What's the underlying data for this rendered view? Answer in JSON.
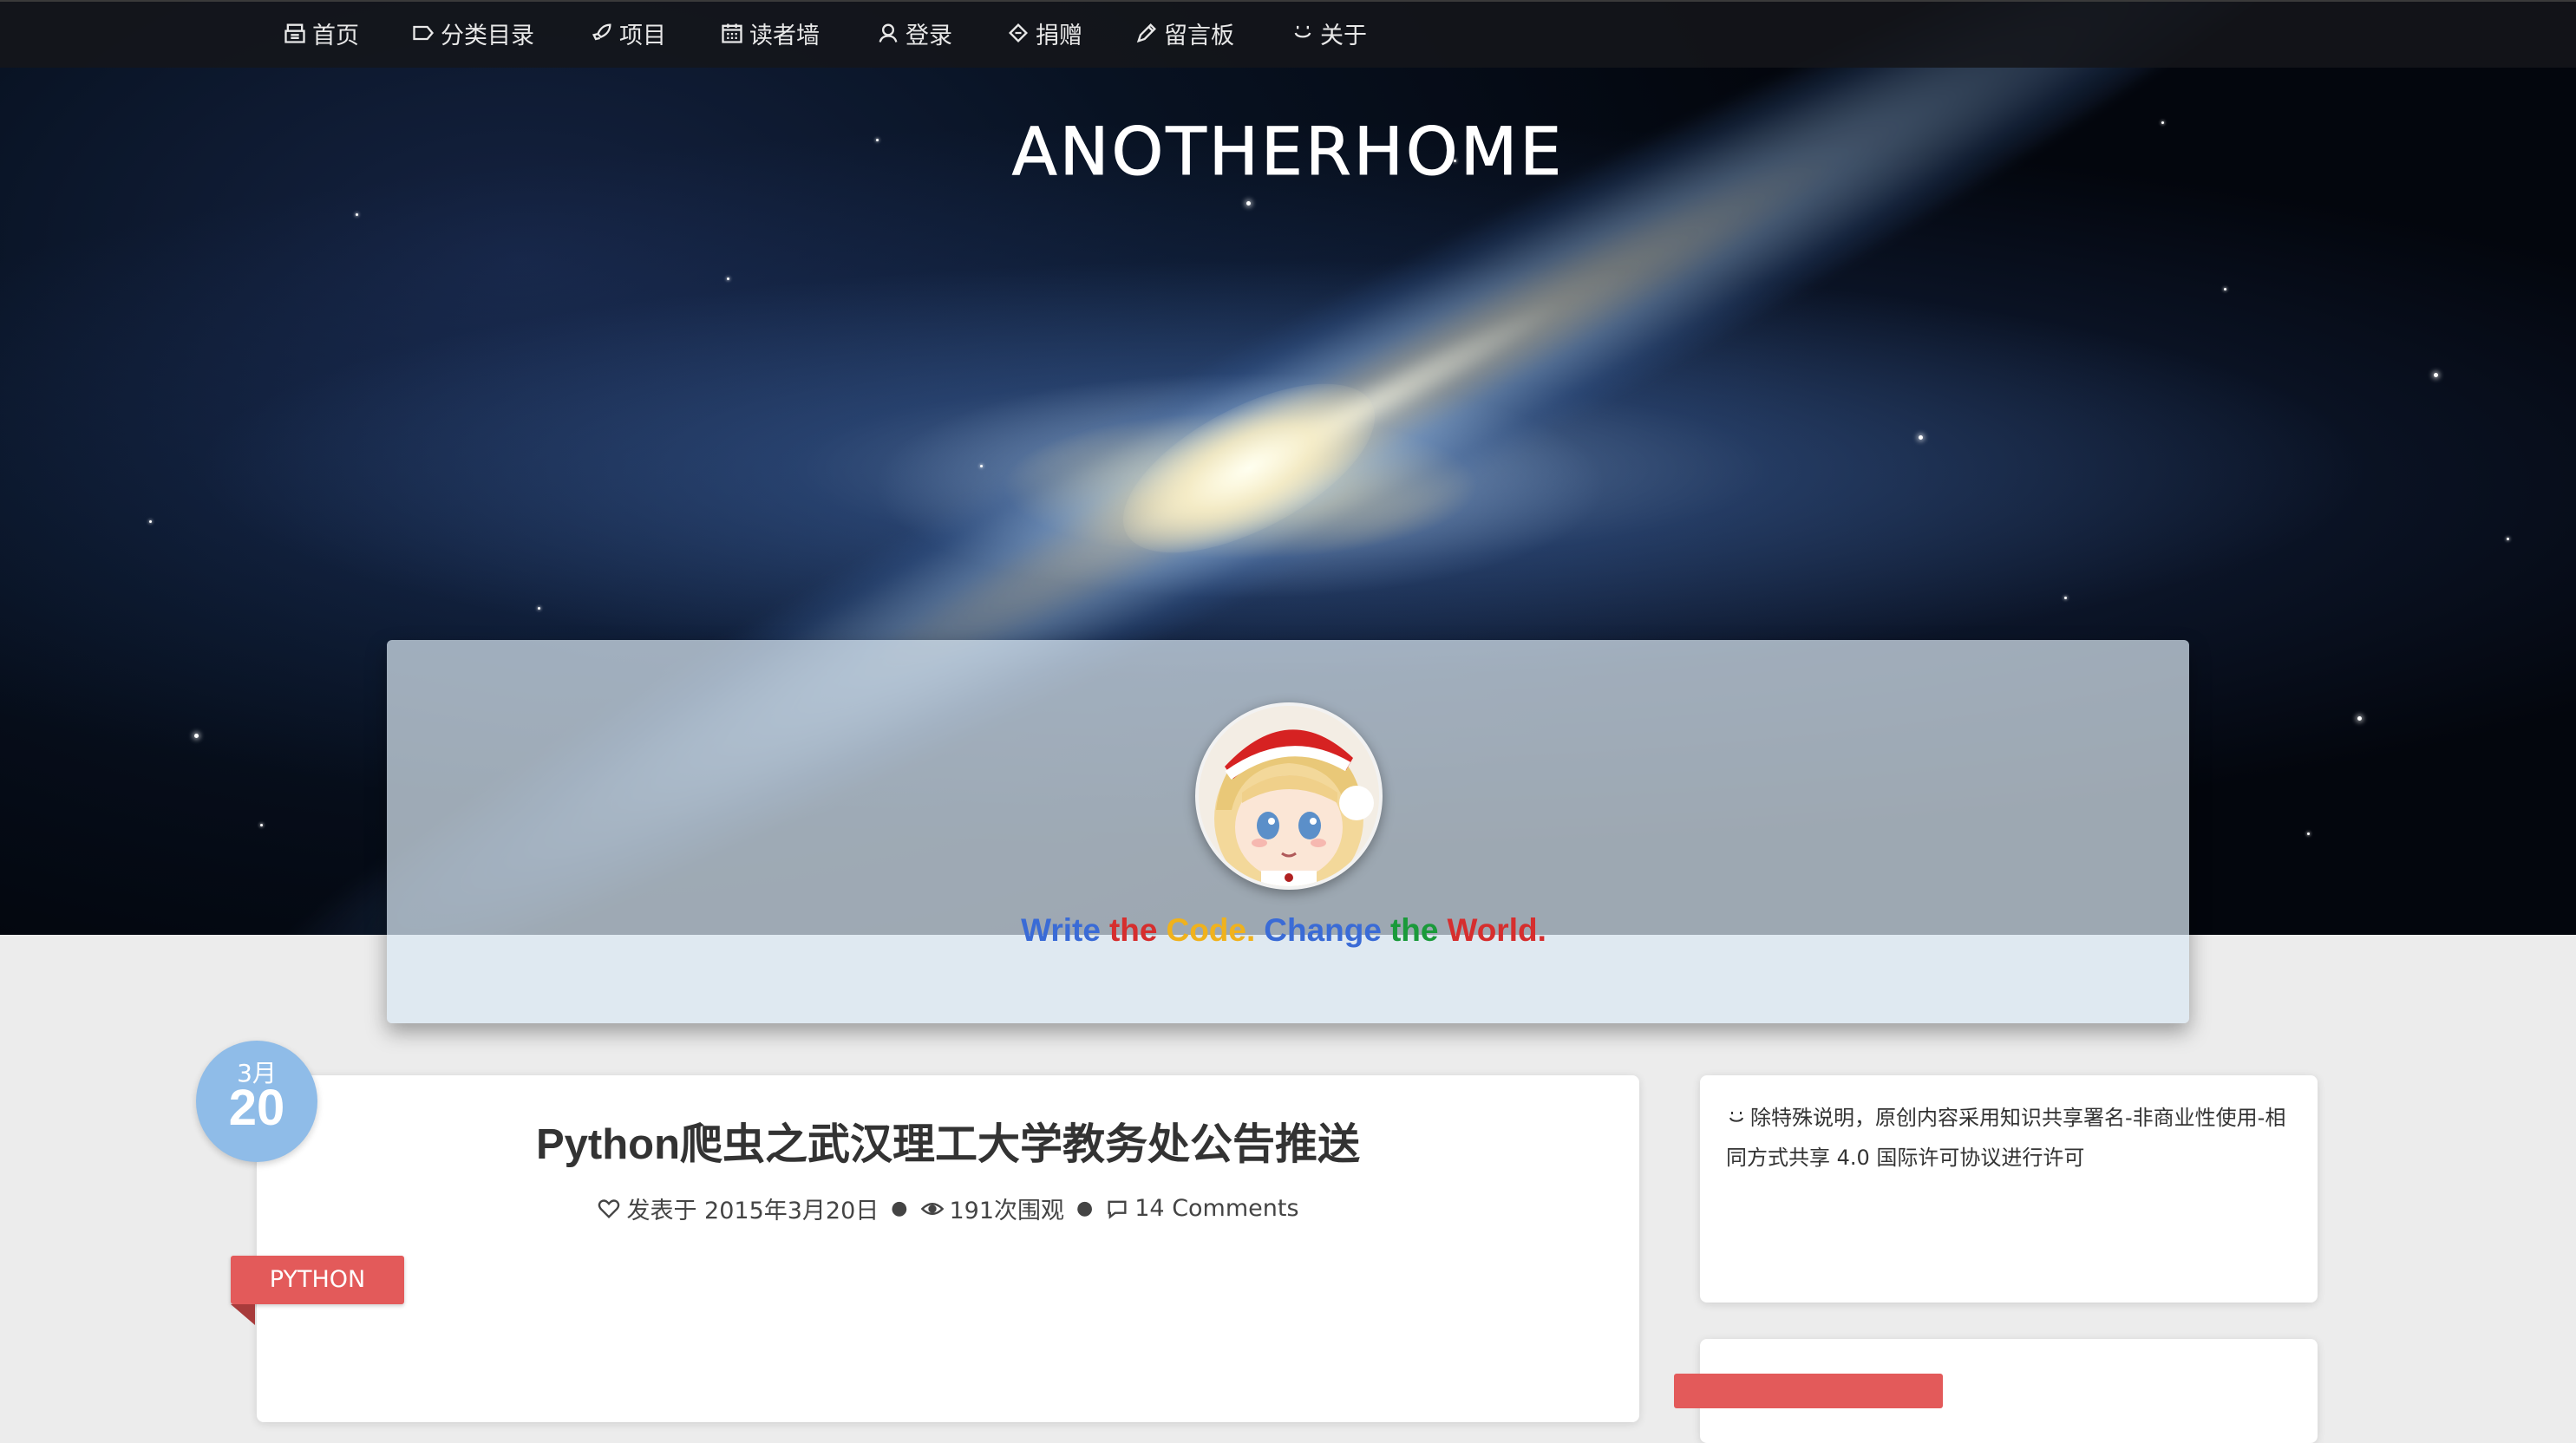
{
  "nav": {
    "items": [
      {
        "label": "首页",
        "icon": "home-icon"
      },
      {
        "label": "分类目录",
        "icon": "tag-icon"
      },
      {
        "label": "项目",
        "icon": "rocket-icon"
      },
      {
        "label": "读者墙",
        "icon": "calendar-icon"
      },
      {
        "label": "登录",
        "icon": "user-icon"
      },
      {
        "label": "捐赠",
        "icon": "ticket-icon"
      },
      {
        "label": "留言板",
        "icon": "pencil-icon"
      },
      {
        "label": "关于",
        "icon": "smile-icon"
      }
    ]
  },
  "site": {
    "logo": "ANOTHERHOME"
  },
  "profile": {
    "tagline": [
      {
        "text": "Write",
        "color": "#3a6bd6"
      },
      {
        "text": "the",
        "color": "#d62e2e"
      },
      {
        "text": "Code.",
        "color": "#f0b21c"
      },
      {
        "text": "Change",
        "color": "#3a6bd6"
      },
      {
        "text": "the",
        "color": "#1a9a3a"
      },
      {
        "text": "World.",
        "color": "#d62e2e"
      }
    ]
  },
  "post": {
    "date_month": "3月",
    "date_day": "20",
    "title": "Python爬虫之武汉理工大学教务处公告推送",
    "meta": {
      "published": "发表于 2015年3月20日",
      "views": "191次围观",
      "comments": "14 Comments"
    },
    "category": "PYTHON"
  },
  "sidebar": {
    "license": "除特殊说明，原创内容采用知识共享署名-非商业性使用-相同方式共享 4.0 国际许可协议进行许可"
  },
  "colors": {
    "accent_red": "#e35a5a",
    "date_badge": "#8fbce8",
    "nav_bg": "#16181c"
  }
}
